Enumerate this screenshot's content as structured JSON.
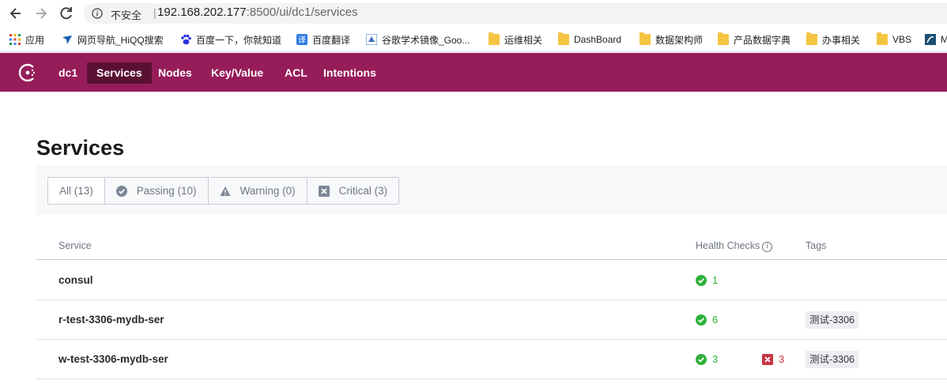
{
  "browser": {
    "security_label": "不安全",
    "separator": "|",
    "url_host": "192.168.202.177",
    "url_rest": ":8500/ui/dc1/services"
  },
  "bookmarks": [
    {
      "label": "应用",
      "icon": "apps-grid-icon"
    },
    {
      "label": "网页导航_HiQQ搜索",
      "icon": "bird-icon"
    },
    {
      "label": "百度一下，你就知道",
      "icon": "baidu-paw-icon"
    },
    {
      "label": "百度翻译",
      "icon": "translate-icon"
    },
    {
      "label": "谷歌学术镜像_Goo...",
      "icon": "scholar-icon"
    },
    {
      "label": "运维相关",
      "icon": "folder-icon"
    },
    {
      "label": "DashBoard",
      "icon": "folder-icon"
    },
    {
      "label": "数据架构师",
      "icon": "folder-icon"
    },
    {
      "label": "产品数据字典",
      "icon": "folder-icon"
    },
    {
      "label": "办事相关",
      "icon": "folder-icon"
    },
    {
      "label": "VBS",
      "icon": "folder-icon"
    },
    {
      "label": "M",
      "icon": "mysql-icon"
    }
  ],
  "topnav": {
    "datacenter": "dc1",
    "items": [
      {
        "label": "Services",
        "active": true
      },
      {
        "label": "Nodes",
        "active": false
      },
      {
        "label": "Key/Value",
        "active": false
      },
      {
        "label": "ACL",
        "active": false
      },
      {
        "label": "Intentions",
        "active": false
      }
    ]
  },
  "page": {
    "title": "Services",
    "filters": [
      {
        "label": "All (13)",
        "icon": "",
        "active": true
      },
      {
        "label": "Passing (10)",
        "icon": "passing-check-icon",
        "active": false
      },
      {
        "label": "Warning (0)",
        "icon": "warning-triangle-icon",
        "active": false
      },
      {
        "label": "Critical (3)",
        "icon": "critical-x-icon",
        "active": false
      }
    ],
    "columns": {
      "service": "Service",
      "health_checks": "Health Checks",
      "tags": "Tags"
    },
    "rows": [
      {
        "name": "consul",
        "passing": "1",
        "critical": "",
        "tag": ""
      },
      {
        "name": "r-test-3306-mydb-ser",
        "passing": "6",
        "critical": "",
        "tag": "测试-3306"
      },
      {
        "name": "w-test-3306-mydb-ser",
        "passing": "3",
        "critical": "3",
        "tag": "测试-3306"
      }
    ]
  },
  "colors": {
    "brand": "#961d59",
    "brand_active": "#5a1032",
    "passing": "#2eb039",
    "critical": "#c73445"
  }
}
